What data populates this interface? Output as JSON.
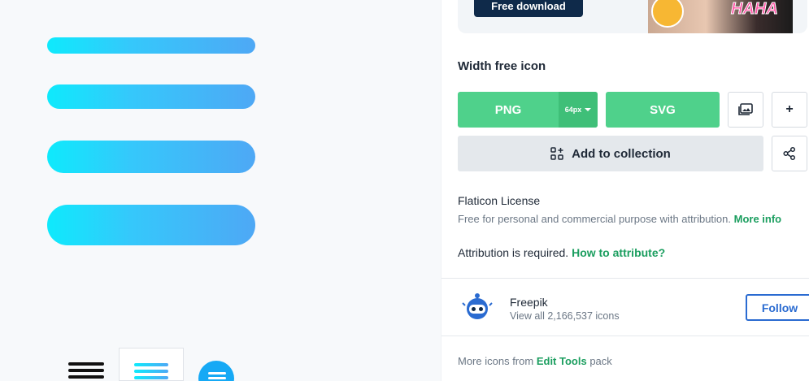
{
  "promo": {
    "button_label": "Free download",
    "sticker_text": "HAHA"
  },
  "download": {
    "section_title": "Width free icon",
    "png_label": "PNG",
    "png_size": "64px",
    "svg_label": "SVG",
    "image_icon": "image-icon",
    "plus_label": "+",
    "add_collection_label": "Add to collection",
    "collection_icon": "add-collection-icon",
    "share_icon": "share-icon"
  },
  "license": {
    "title": "Flaticon License",
    "description": "Free for personal and commercial purpose with attribution.",
    "more_info": "More info",
    "attribution_text": "Attribution is required.",
    "how_to_attribute": "How to attribute?"
  },
  "author": {
    "name": "Freepik",
    "count_text": "View all 2,166,537 icons",
    "follow_label": "Follow"
  },
  "more": {
    "prefix": "More icons from",
    "pack_name": "Edit Tools",
    "suffix": "pack"
  },
  "colors": {
    "green": "#4fd18b",
    "green_dark": "#3fbf78",
    "navy": "#0f2a4a",
    "blue": "#2a6bd1",
    "link_green": "#1b9e5f",
    "gradient_start": "#0eeafc",
    "gradient_end": "#4ea8f5"
  }
}
